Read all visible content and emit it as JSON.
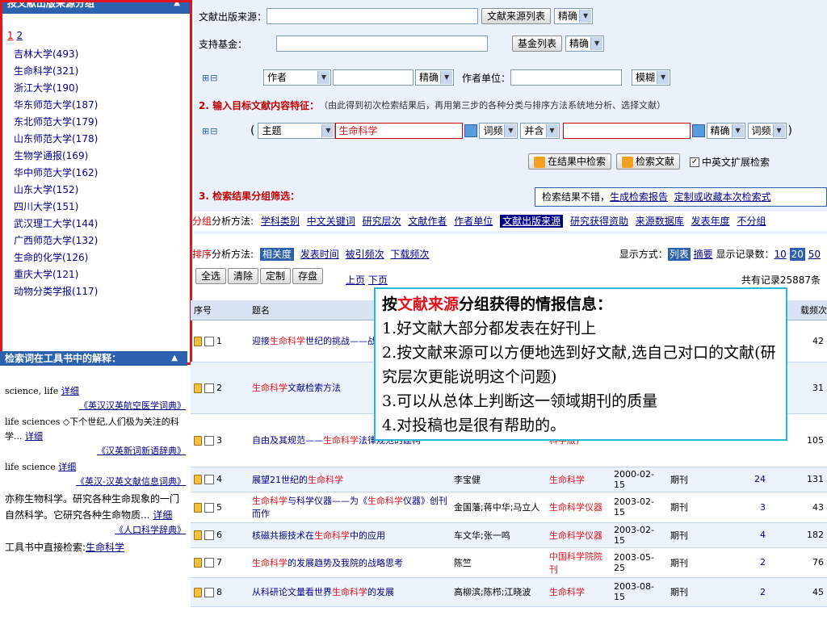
{
  "left_panel": {
    "source_group_header": "按文献出版来源分组",
    "pager_current": "1",
    "pager_next": "2",
    "sources": [
      "吉林大学(493)",
      "生命科学(321)",
      "浙江大学(190)",
      "华东师范大学(187)",
      "东北师范大学(179)",
      "山东师范大学(178)",
      "生物学通报(169)",
      "华中师范大学(162)",
      "山东大学(152)",
      "四川大学(151)",
      "武汉理工大学(144)",
      "广西师范大学(132)",
      "生命的化学(126)",
      "重庆大学(121)",
      "动物分类学报(117)"
    ],
    "search_term_header": "检索词在工具书中的解释：",
    "dict_entries": [
      {
        "text": "science, life",
        "link": "详细",
        "source": "《英汉汉英航空医学词典》"
      },
      {
        "text": "life sciences ◇下个世纪,人们极为关注的科学...",
        "link": "详细",
        "source": "《汉英新词新语辞典》"
      },
      {
        "text": "life science",
        "link": "详细",
        "source": "《英汉-汉英文献信息词典》"
      },
      {
        "text": "亦称生物科学。研究各种生命现象的一门自然科学。它研究各种生命物质...",
        "link": "详细",
        "source": "《人口科学辞典》"
      }
    ],
    "footer_text": "工具书中直接检索:",
    "footer_link": "生命科学"
  },
  "form": {
    "source_label": "文献出版来源：",
    "source_list_btn": "文献来源列表",
    "precise": "精确",
    "fund_label": "支持基金：",
    "fund_list_btn": "基金列表",
    "plus_minus": "⊞⊟",
    "author_field": "作者",
    "author_unit_label": "作者单位：",
    "fuzzy": "模糊",
    "step2_label": "2. 输入目标文献内容特征：",
    "step2_hint": "（由此得到初次检索结果后，再用第三步的各种分类与排序方法系统地分析、选择文献）",
    "open_paren": "(",
    "close_paren": ")",
    "topic_field": "主题",
    "topic_value": "生命科学",
    "word_freq": "词频",
    "and_op": "并含",
    "search_in_results_btn": "在结果中检索",
    "search_btn": "检索文献",
    "ext_search_label": "中英文扩展检索",
    "step3_label": "3. 检索结果分组筛选：",
    "report_prefix": "检索结果不错，",
    "report_link1": "生成检索报告",
    "report_link2": "定制或收藏本次检索式"
  },
  "group_bar": {
    "prefix_red": "分组",
    "prefix": "分析方法:",
    "items": [
      "学科类别",
      "中文关键词",
      "研究层次",
      "文献作者",
      "作者单位",
      "文献出版来源",
      "研究获得资助",
      "来源数据库",
      "发表年度",
      "不分组"
    ],
    "active_index": 5
  },
  "sort_bar": {
    "prefix_red": "排序",
    "prefix": "分析方法:",
    "items": [
      "相关度",
      "发表时间",
      "被引频次",
      "下载频次"
    ],
    "active_index": 0,
    "display_label": "显示方式：",
    "display_list": "列表",
    "display_summary": "摘要",
    "count_label": "显示记录数：",
    "counts": [
      "10",
      "20",
      "50"
    ],
    "active_count": "20"
  },
  "toolbar": {
    "select_all": "全选",
    "clear": "清除",
    "customize": "定制",
    "save": "存盘",
    "prev_page": "上页",
    "next_page": "下页",
    "total": "共有记录25887条"
  },
  "table": {
    "headers": [
      "序号",
      "题名",
      "",
      "",
      "",
      "",
      "",
      "载频次"
    ],
    "rows": [
      {
        "n": "1",
        "title": "迎接生命科学世纪的挑战——战略调研报告(概要)",
        "author": "",
        "source": "",
        "date": "",
        "type": "",
        "cited": "",
        "dl": "42"
      },
      {
        "n": "2",
        "title": "生命科学文献检索方法",
        "author": "",
        "source": "",
        "date": "",
        "type": "",
        "cited": "",
        "dl": "31"
      },
      {
        "n": "3",
        "title": "自由及其规范——生命科学法律规范的建构",
        "author": "",
        "source": "科学版)",
        "date": "",
        "type": "",
        "cited": "",
        "dl": "105"
      },
      {
        "n": "4",
        "title": "展望21世纪的生命科学",
        "author": "李宝健",
        "source": "生命科学",
        "date": "2000-02-15",
        "type": "期刊",
        "cited": "24",
        "dl": "131"
      },
      {
        "n": "5",
        "title": "生命科学与科学仪器——为《生命科学仪器》创刊而作",
        "author": "金国藩;蒋中华;马立人",
        "source": "生命科学仪器",
        "date": "2003-02-15",
        "type": "期刊",
        "cited": "3",
        "dl": "43"
      },
      {
        "n": "6",
        "title": "核磁共振技术在生命科学中的应用",
        "author": "车文华;张一鸣",
        "source": "生命科学仪器",
        "date": "2003-02-15",
        "type": "期刊",
        "cited": "4",
        "dl": "182"
      },
      {
        "n": "7",
        "title": "生命科学的发展趋势及我院的战略思考",
        "author": "陈竺",
        "source": "中国科学院院刊",
        "date": "2003-05-25",
        "type": "期刊",
        "cited": "2",
        "dl": "76"
      },
      {
        "n": "8",
        "title": "从科研论文量看世界生命科学的发展",
        "author": "高柳滨;陈栉;江晓波",
        "source": "生命科学",
        "date": "2003-08-15",
        "type": "期刊",
        "cited": "2",
        "dl": "45"
      }
    ]
  },
  "callout": {
    "title_prefix": "按",
    "title_highlight": "文献来源",
    "title_suffix": "分组获得的情报信息：",
    "line1": "1.好文献大部分都发表在好刊上",
    "line2": "2.按文献来源可以方便地选到好文献,选自己对口的文献(研究层次更能说明这个问题)",
    "line3": "3.可以从总体上判断这一领域期刊的质量",
    "line4": "4.对投稿也是很有帮助的。"
  },
  "colors": {
    "highlight_red": "#e0141e",
    "header_blue": "#2c62ad",
    "callout_border": "#29b8d8",
    "form_bg": "#eaf1fb"
  }
}
